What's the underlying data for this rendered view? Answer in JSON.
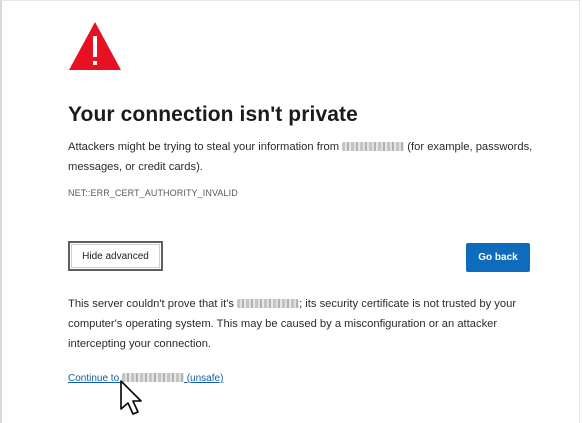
{
  "page": {
    "title": "Your connection isn't private",
    "description_before_host": "Attackers might be trying to steal your information from ",
    "description_after_host": " (for example, passwords, messages, or credit cards).",
    "error_code": "NET::ERR_CERT_AUTHORITY_INVALID"
  },
  "buttons": {
    "hide_advanced": "Hide advanced",
    "go_back": "Go back"
  },
  "advanced": {
    "text_before_host": "This server couldn't prove that it's ",
    "text_after_host": "; its security certificate is not trusted by your computer's operating system. This may be caused by a misconfiguration or an attacker intercepting your connection.",
    "continue_prefix": "Continue to ",
    "continue_suffix": " (unsafe)"
  },
  "icons": {
    "warning": "warning-triangle-icon",
    "cursor": "mouse-pointer-icon"
  },
  "colors": {
    "warning_red": "#e81123",
    "primary_button": "#0f6cbd",
    "link": "#0f5da8"
  }
}
